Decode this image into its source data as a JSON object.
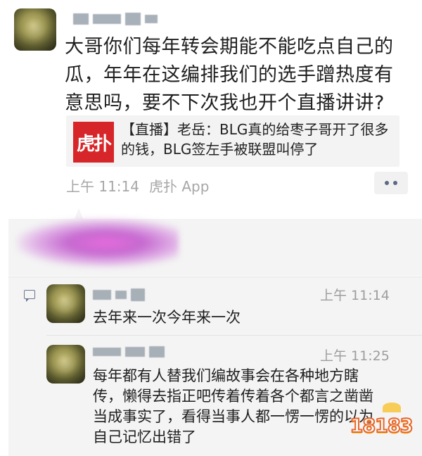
{
  "post": {
    "text": "大哥你们每年转会期能不能吃点自己的瓜，年年在这编排我们的选手蹭热度有意思吗，要不下次我也开个直播讲讲?",
    "link": {
      "logo": "虎扑",
      "text": "【直播】老岳：BLG真的给枣子哥开了很多的钱，BLG签左手被联盟叫停了"
    },
    "time": "上午 11:14",
    "source": "虎扑 App"
  },
  "comments": [
    {
      "time": "上午 11:14",
      "text": "去年来一次今年来一次"
    },
    {
      "time": "上午 11:25",
      "text": "每年都有人替我们编故事会在各种地方瞎传，懒得去指正吧传着传着各个都言之凿凿当成事实了，看得当事人都一愣一愣的以为自己记忆出错了"
    }
  ],
  "watermark": "18183",
  "icons": {
    "more": "more-dots-icon",
    "comment": "comment-icon"
  }
}
